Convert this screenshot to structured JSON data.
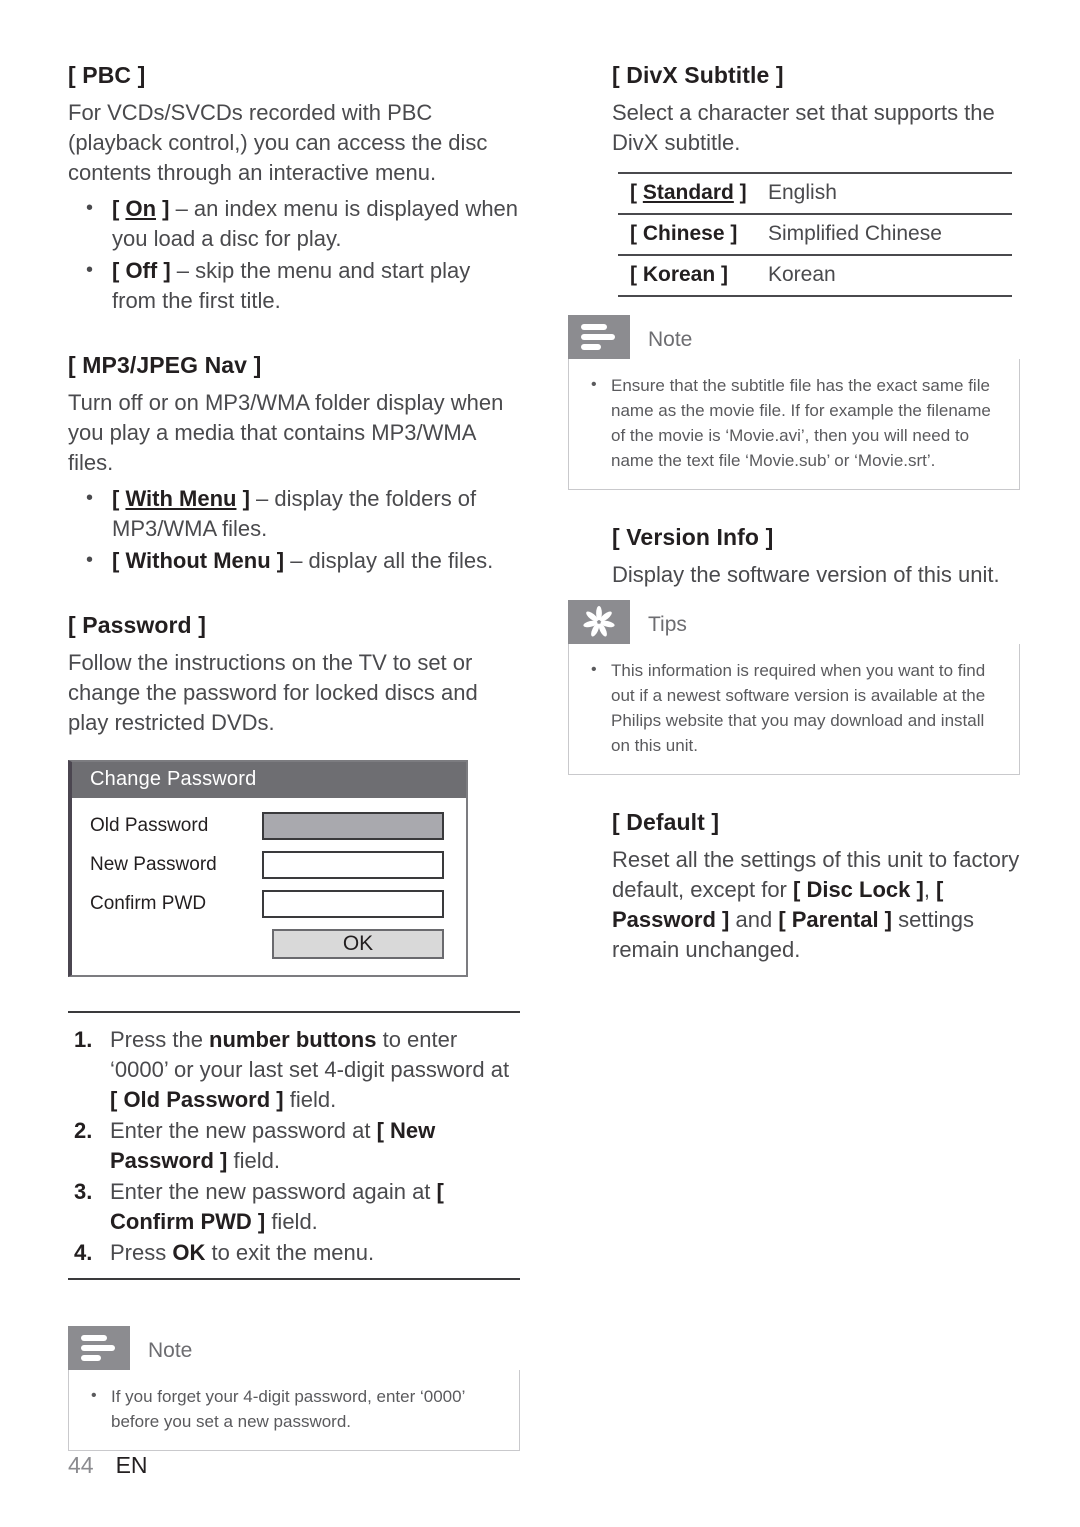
{
  "left": {
    "pbc": {
      "heading": "[ PBC ]",
      "body": "For VCDs/SVCDs recorded with PBC (playback control,) you can access the disc contents through an interactive menu.",
      "bullets": [
        {
          "key": "[ On ]",
          "key_underline": "On",
          "text": " – an index menu is displayed when you load a disc for play."
        },
        {
          "key": "[ Off ]",
          "text": " – skip the menu and start play from the first title."
        }
      ]
    },
    "mp3jpeg": {
      "heading": "[ MP3/JPEG Nav ]",
      "body": "Turn off or on MP3/WMA folder display when you play a media that contains MP3/WMA files.",
      "bullets": [
        {
          "key": "[ With Menu ]",
          "key_underline": "With Menu",
          "text": " – display the folders of MP3/WMA files."
        },
        {
          "key": "[ Without Menu ]",
          "text": " – display all the files."
        }
      ]
    },
    "password": {
      "heading": "[ Password ]",
      "body": "Follow the instructions on the TV to set or change the password for locked discs and play restricted DVDs."
    },
    "dialog": {
      "title": "Change Password",
      "rows": [
        {
          "label": "Old Password",
          "focused": true
        },
        {
          "label": "New Password",
          "focused": false
        },
        {
          "label": "Confirm PWD",
          "focused": false
        }
      ],
      "ok_label": "OK"
    },
    "steps": [
      {
        "num": "1.",
        "text": "Press the number buttons to enter ‘0000’ or your last set 4-digit password at [ Old Password ] field."
      },
      {
        "num": "2.",
        "text": "Enter the new password at [ New Password ] field."
      },
      {
        "num": "3.",
        "text": "Enter the new password again at [ Confirm PWD ] field."
      },
      {
        "num": "4.",
        "text": "Press OK to exit the menu."
      }
    ],
    "note": {
      "label": "Note",
      "icon": "note-lines-icon",
      "items": [
        "If you forget your 4-digit password, enter ‘0000’ before you set a new password."
      ]
    }
  },
  "right": {
    "divx": {
      "heading": "[ DivX Subtitle ]",
      "body": "Select a character set that supports the DivX subtitle.",
      "table": {
        "rows": [
          {
            "key": "[ Standard ]",
            "key_underline": "Standard",
            "value": "English"
          },
          {
            "key": "[ Chinese ]",
            "value": "Simplified Chinese"
          },
          {
            "key": "[ Korean ]",
            "value": "Korean"
          }
        ]
      }
    },
    "note": {
      "label": "Note",
      "icon": "note-lines-icon",
      "items": [
        "Ensure that the subtitle file has the exact same file name as the movie file. If for example the filename of the movie is ‘Movie.avi’, then you will need to name the text file ‘Movie.sub’ or ‘Movie.srt’."
      ]
    },
    "version": {
      "heading": "[ Version Info ]",
      "body": "Display the software version of this unit."
    },
    "tips": {
      "label": "Tips",
      "icon": "asterisk-burst-icon",
      "items": [
        "This information is required when you want to find out if a newest software version is available at the Philips website that you may download and install on this unit."
      ]
    },
    "default": {
      "heading": "[ Default ]",
      "body": "Reset all the settings of this unit to factory default, except for [ Disc Lock ], [ Password ] and [ Parental ] settings remain unchanged."
    }
  },
  "footer": {
    "page_number": "44",
    "language": "EN"
  },
  "colors": {
    "callout_icon_bg": "#8c8c90",
    "dialog_title_bg": "#6e6e72",
    "dialog_focused_field": "#a9a9ae",
    "dialog_ok_bg": "#d9d9d9",
    "text_body": "#4a4a4d",
    "text_heading": "#231f20"
  }
}
